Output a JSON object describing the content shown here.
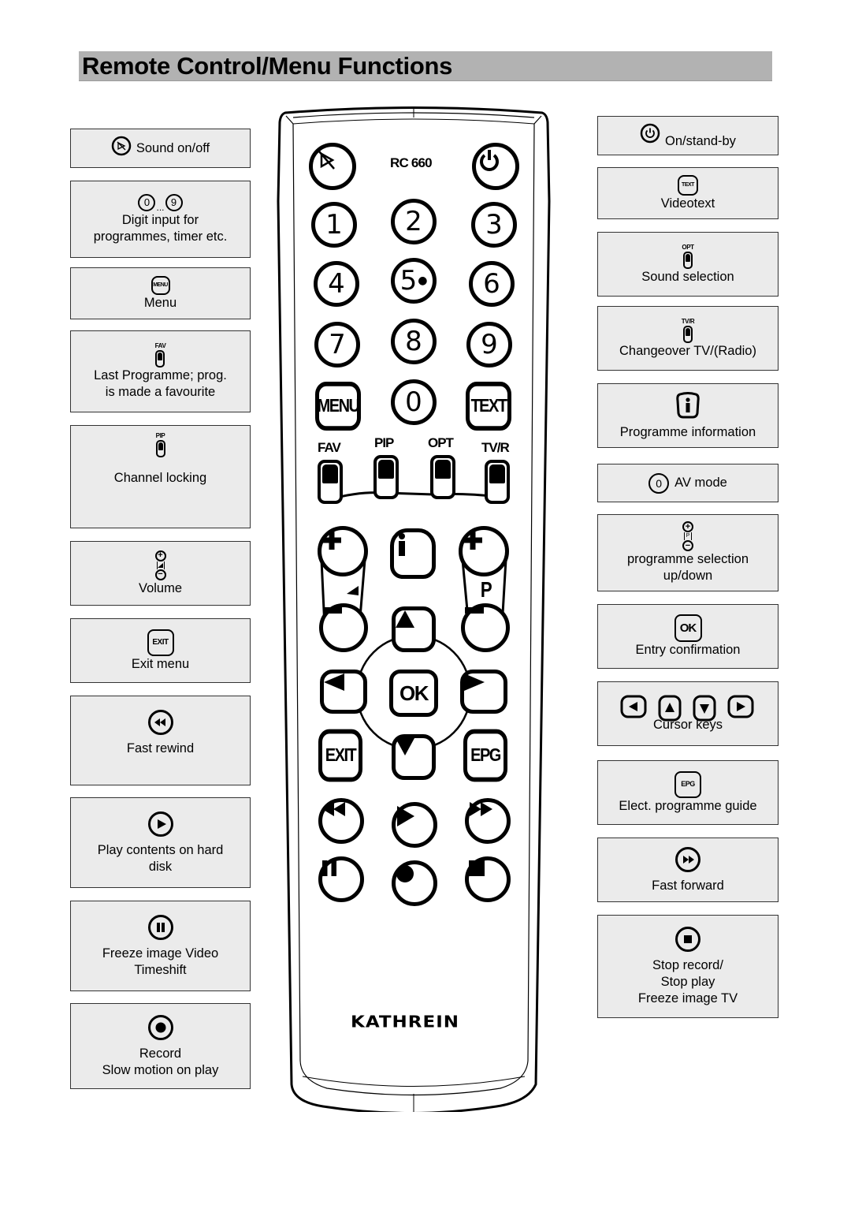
{
  "title": "Remote Control/Menu Functions",
  "remote": {
    "model": "RC 660",
    "brand": "KATHREIN",
    "digits": [
      "1",
      "2",
      "3",
      "4",
      "5",
      "6",
      "7",
      "8",
      "9",
      "0"
    ],
    "keys": {
      "menu": "MENU",
      "text": "TEXT",
      "ok": "OK",
      "exit": "EXIT",
      "epg": "EPG",
      "fav": "FAV",
      "pip": "PIP",
      "opt": "OPT",
      "tvr": "TV/R",
      "prog": "P"
    }
  },
  "left_panels": [
    {
      "icon": "mute-icon",
      "label": "Sound on/off"
    },
    {
      "icon": "digit-icon",
      "digit_from": "0",
      "digit_sep": "...",
      "digit_to": "9",
      "label": "Digit input for\nprogrammes, timer etc."
    },
    {
      "icon": "menu-key-icon",
      "key": "MENU",
      "label": "Menu"
    },
    {
      "icon": "fav-rocker-icon",
      "key": "FAV",
      "label": "Last Programme; prog.\nis made a favourite"
    },
    {
      "icon": "pip-rocker-icon",
      "key": "PIP",
      "label": "Channel locking"
    },
    {
      "icon": "volume-icon",
      "label": "Volume"
    },
    {
      "icon": "exit-key-icon",
      "key": "EXIT",
      "label": "Exit menu"
    },
    {
      "icon": "rewind-icon",
      "label": "Fast rewind"
    },
    {
      "icon": "play-icon",
      "label": "Play contents on hard\ndisk"
    },
    {
      "icon": "pause-icon",
      "label": "Freeze image Video\nTimeshift"
    },
    {
      "icon": "record-icon",
      "label": "Record\nSlow motion on play"
    }
  ],
  "right_panels": [
    {
      "icon": "power-icon",
      "label": "On/stand-by"
    },
    {
      "icon": "text-key-icon",
      "key": "TEXT",
      "label": "Videotext"
    },
    {
      "icon": "opt-rocker-icon",
      "key": "OPT",
      "label": "Sound selection"
    },
    {
      "icon": "tvr-rocker-icon",
      "key": "TV/R",
      "label": "Changeover TV/(Radio)"
    },
    {
      "icon": "info-key-icon",
      "label": "Programme information"
    },
    {
      "icon": "zero-icon",
      "digit": "0",
      "label": "AV mode"
    },
    {
      "icon": "programme-icon",
      "key": "P",
      "label": "programme selection\nup/down"
    },
    {
      "icon": "ok-key-icon",
      "key": "OK",
      "label": "Entry confirmation"
    },
    {
      "icon": "cursor-keys-icon",
      "label": "Cursor keys"
    },
    {
      "icon": "epg-key-icon",
      "key": "EPG",
      "label": "Elect. programme guide"
    },
    {
      "icon": "fast-forward-icon",
      "label": "Fast forward"
    },
    {
      "icon": "stop-icon",
      "label": "Stop record/\nStop play\nFreeze image TV"
    }
  ]
}
